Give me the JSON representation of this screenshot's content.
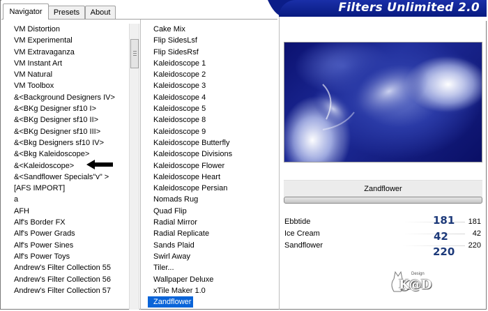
{
  "window": {
    "title": "Filters Unlimited 2.0"
  },
  "tabs": [
    {
      "label": "Navigator",
      "active": true
    },
    {
      "label": "Presets",
      "active": false
    },
    {
      "label": "About",
      "active": false
    }
  ],
  "categories": [
    "VM Distortion",
    "VM Experimental",
    "VM Extravaganza",
    "VM Instant Art",
    "VM Natural",
    "VM Toolbox",
    "&<Background Designers IV>",
    "&<BKg Designer sf10 I>",
    "&<BKg Designer sf10 II>",
    "&<BKg Designer sf10 III>",
    "&<Bkg Designers sf10 IV>",
    "&<Bkg Kaleidoscope>",
    "&<Kaleidoscope>",
    "&<Sandflower Specials\"v\" >",
    "[AFS IMPORT]",
    "a",
    "AFH",
    "Alf's Border FX",
    "Alf's Power Grads",
    "Alf's Power Sines",
    "Alf's Power Toys",
    "Andrew's Filter Collection 55",
    "Andrew's Filter Collection 56",
    "Andrew's Filter Collection 57"
  ],
  "filters": [
    "Cake Mix",
    "Flip SidesLsf",
    "Flip SidesRsf",
    "Kaleidoscope 1",
    "Kaleidoscope 2",
    "Kaleidoscope 3",
    "Kaleidoscope 4",
    "Kaleidoscope 5",
    "Kaleidoscope 8",
    "Kaleidoscope 9",
    "Kaleidoscope Butterfly",
    "Kaleidoscope Divisions",
    "Kaleidoscope Flower",
    "Kaleidoscope Heart",
    "Kaleidoscope Persian",
    "Nomads Rug",
    "Quad Flip",
    "Radial Mirror",
    "Radial Replicate",
    "Sands Plaid",
    "Swirl Away",
    "Tiler...",
    "Wallpaper Deluxe",
    "xTile Maker 1.0",
    "Zandflower"
  ],
  "selected_filter_index": 24,
  "preview": {
    "filter_name": "Zandflower"
  },
  "parameters": [
    {
      "label": "Ebbtide",
      "value": "181",
      "annotation": "181"
    },
    {
      "label": "Ice Cream",
      "value": "42",
      "annotation": "42"
    },
    {
      "label": "Sandflower",
      "value": "220",
      "annotation": "220"
    }
  ],
  "watermark": {
    "small": "Design",
    "text": "K@D"
  },
  "colors": {
    "accent": "#0a64d8",
    "banner": "#0b1d88",
    "annotation": "#1d3a7a"
  }
}
